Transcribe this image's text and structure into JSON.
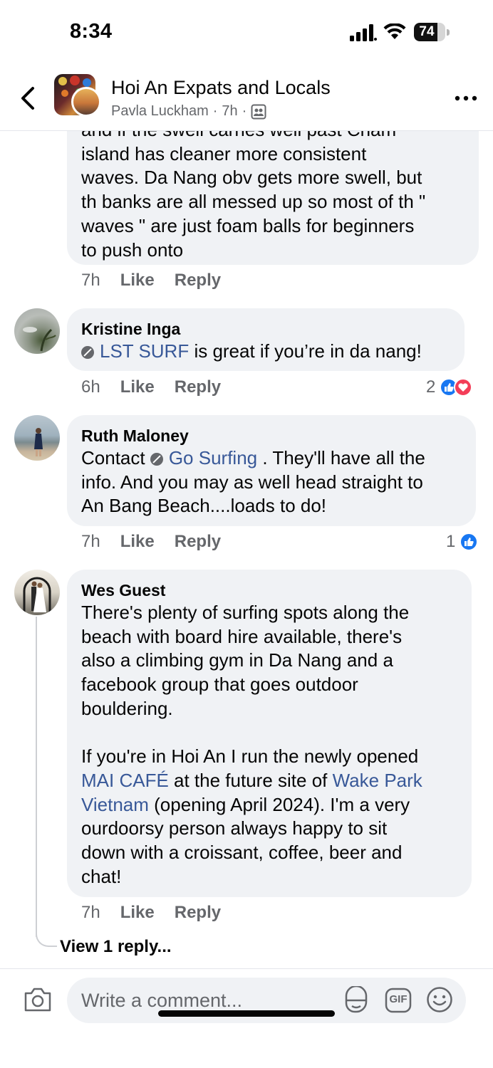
{
  "status_bar": {
    "time": "8:34",
    "battery": "74",
    "battery_level": 0.74
  },
  "header": {
    "group_name": "Hoi An Expats and Locals",
    "author": "Pavla Luckham",
    "time": "7h",
    "separator": "·"
  },
  "comments": [
    {
      "partial_text": "and if the swell carries well past Cham island has cleaner more consistent waves. Da Nang obv gets more swell, but th banks are all messed up so most of th \" waves \" are just foam balls for beginners to push onto",
      "lines": [
        "and if the swell carries well past Cham",
        "island has cleaner more consistent",
        "waves. Da Nang obv gets more swell, but",
        "th banks are all messed up so most of th \"",
        "waves \" are just foam balls for beginners",
        "to push onto"
      ],
      "time": "7h",
      "like": "Like",
      "reply": "Reply"
    },
    {
      "author": "Kristine Inga",
      "mention": "LST SURF",
      "text_after": " is great if you’re in da nang!",
      "time": "6h",
      "like": "Like",
      "reply": "Reply",
      "reaction_count": "2"
    },
    {
      "author": "Ruth Maloney",
      "text_before": "Contact ",
      "mention": "Go Surfing",
      "text_after_lines": [
        " . They'll have all the",
        "info. And you may as well head straight to",
        "An Bang Beach....loads to do!"
      ],
      "time": "7h",
      "like": "Like",
      "reply": "Reply",
      "reaction_count": "1"
    },
    {
      "author": "Wes Guest",
      "para1_lines": [
        "There's plenty of surfing spots along the",
        "beach with board hire available, there's",
        "also a climbing gym in Da Nang and a",
        "facebook group that goes outdoor",
        "bouldering."
      ],
      "para2_line1_before": "If you're in Hoi An I run the newly opened",
      "mention1": "MAI CAFÉ",
      "para2_mid": " at the future site of ",
      "mention2_a": "Wake Park",
      "mention2_b": "Vietnam",
      "para2_rest_lines": [
        " (opening April 2024). I'm a very",
        "ourdoorsy person always happy to sit",
        "down with a croissant, coffee, beer and",
        "chat!"
      ],
      "time": "7h",
      "like": "Like",
      "reply": "Reply",
      "view_replies": "View 1 reply..."
    }
  ],
  "composer": {
    "placeholder": "Write a comment...",
    "gif": "GIF"
  },
  "icons": [
    "back-arrow-icon",
    "more-icon",
    "group-members-icon",
    "like-reaction-icon",
    "love-reaction-icon",
    "camera-icon",
    "sticker-icon",
    "gif-icon",
    "emoji-icon",
    "signal-icon",
    "wifi-icon",
    "battery-icon"
  ],
  "colors": {
    "link": "#385898",
    "bubble": "#f0f2f5",
    "secondary_text": "#65676b",
    "like_blue": "#1877f2",
    "love_red": "#f33e58"
  }
}
